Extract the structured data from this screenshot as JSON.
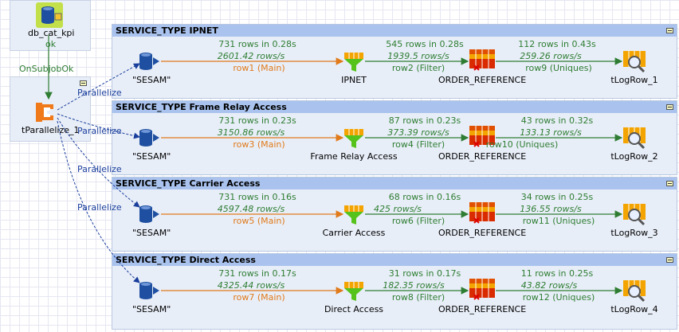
{
  "top_job": {
    "label": "db_cat_kpi",
    "status": "ok"
  },
  "trigger_label": "OnSubjobOk",
  "parallel": {
    "label": "tParallelize_1",
    "link_label": "Parallelize"
  },
  "lanes": [
    {
      "title": "SERVICE_TYPE IPNET",
      "source": "\"SESAM\"",
      "filter": "IPNET",
      "ref": "ORDER_REFERENCE",
      "log": "tLogRow_1",
      "s1": {
        "rows": "731 rows in 0.28s",
        "rate": "2601.42 rows/s",
        "row": "row1 (Main)"
      },
      "s2": {
        "rows": "545 rows in 0.28s",
        "rate": "1939.5 rows/s",
        "row": "row2 (Filter)"
      },
      "s3": {
        "rows": "112 rows in 0.43s",
        "rate": "259.26 rows/s",
        "row": "row9 (Uniques)"
      }
    },
    {
      "title": "SERVICE_TYPE Frame Relay Access",
      "source": "\"SESAM\"",
      "filter": "Frame Relay Access",
      "ref": "ORDER_REFERENCE",
      "log": "tLogRow_2",
      "s1": {
        "rows": "731 rows in 0.23s",
        "rate": "3150.86 rows/s",
        "row": "row3 (Main)"
      },
      "s2": {
        "rows": "87 rows in 0.23s",
        "rate": "373.39 rows/s",
        "row": "row4 (Filter)"
      },
      "s3": {
        "rows": "43 rows in 0.32s",
        "rate": "133.13 rows/s",
        "row": "row10 (Uniques)"
      }
    },
    {
      "title": "SERVICE_TYPE Carrier Access",
      "source": "\"SESAM\"",
      "filter": "Carrier Access",
      "ref": "ORDER_REFERENCE",
      "log": "tLogRow_3",
      "s1": {
        "rows": "731 rows in 0.16s",
        "rate": "4597.48 rows/s",
        "row": "row5 (Main)"
      },
      "s2": {
        "rows": "68 rows in 0.16s",
        "rate": "425 rows/s",
        "row": "row6 (Filter)"
      },
      "s3": {
        "rows": "34 rows in 0.25s",
        "rate": "136.55 rows/s",
        "row": "row11 (Uniques)"
      }
    },
    {
      "title": "SERVICE_TYPE Direct Access",
      "source": "\"SESAM\"",
      "filter": "Direct Access",
      "ref": "ORDER_REFERENCE",
      "log": "tLogRow_4",
      "s1": {
        "rows": "731 rows in 0.17s",
        "rate": "4325.44 rows/s",
        "row": "row7 (Main)"
      },
      "s2": {
        "rows": "31 rows in 0.17s",
        "rate": "182.35 rows/s",
        "row": "row8 (Filter)"
      },
      "s3": {
        "rows": "11 rows in 0.25s",
        "rate": "43.82 rows/s",
        "row": "row12 (Uniques)"
      }
    }
  ],
  "colors": {
    "main_link": "#e07a1a",
    "filter_link": "#2e7d32",
    "parallel_link": "#1a3e9c",
    "lane_header": "#a9c3ee"
  }
}
